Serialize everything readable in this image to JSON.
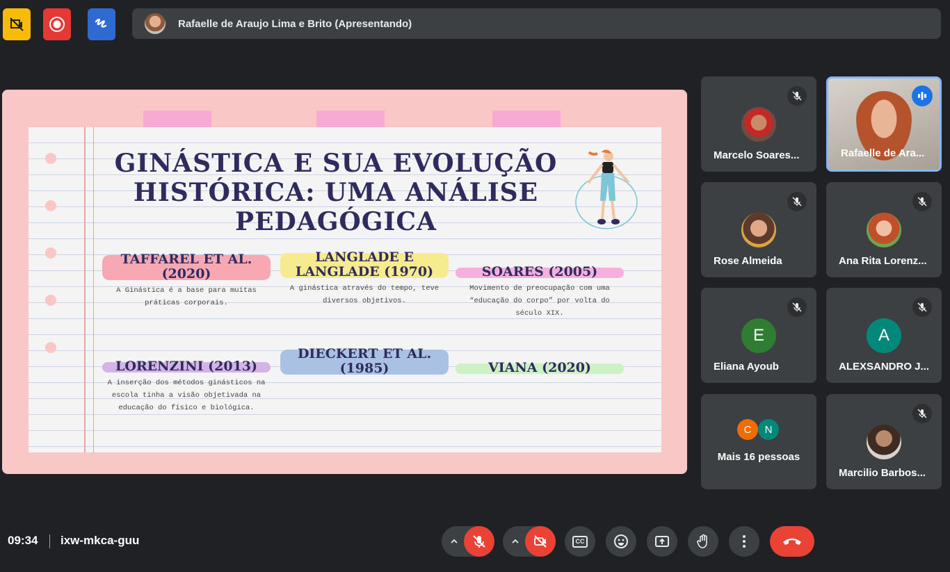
{
  "topbar": {
    "icons": [
      "no-camera-sign-icon",
      "record-icon",
      "whiteboard-icon"
    ],
    "colors": {
      "yellow": "#f9bb0a",
      "red": "#e53935",
      "blue": "#2f6ad0"
    },
    "presenter_label": "Rafaelle de Araujo Lima e Brito (Apresentando)"
  },
  "slide": {
    "title": "GINÁSTICA E SUA EVOLUÇÃO HISTÓRICA: UMA ANÁLISE PEDAGÓGICA",
    "columns": [
      {
        "title": "TAFFAREL ET AL. (2020)",
        "text": "A Ginástica é a base para muitas práticas corporais.",
        "color": "#f7a8b2"
      },
      {
        "title": "LANGLADE E LANGLADE (1970)",
        "text": "A ginástica através do tempo, teve diversos objetivos.",
        "color": "#f7eb8f"
      },
      {
        "title": "SOARES (2005)",
        "text": "Movimento de preocupação com uma “educação do corpo” por volta do século XIX.",
        "color": "#f6b0e0"
      },
      {
        "title": "LORENZINI (2013)",
        "text": "A inserção dos métodos ginásticos na escola tinha a visão objetivada na educação do físico e biológica.",
        "color": "#d4b3e6"
      },
      {
        "title": "DIECKERT ET AL. (1985)",
        "text": "",
        "color": "#a9c2e4"
      },
      {
        "title": "VIANA (2020)",
        "text": "",
        "color": "#cdf0c4"
      }
    ]
  },
  "participants": [
    {
      "name": "Marcelo Soares...",
      "type": "photo",
      "muted": true
    },
    {
      "name": "Rafaelle de Ara...",
      "type": "video",
      "speaking": true
    },
    {
      "name": "Rose Almeida",
      "type": "photo",
      "muted": true
    },
    {
      "name": "Ana Rita Lorenz...",
      "type": "photo",
      "muted": true
    },
    {
      "name": "Eliana Ayoub",
      "type": "initial",
      "initial": "E",
      "color": "#2e7d32",
      "muted": true
    },
    {
      "name": "ALEXSANDRO J...",
      "type": "initial",
      "initial": "A",
      "color": "#00897b",
      "muted": true
    },
    {
      "name": "Mais 16 pessoas",
      "type": "more",
      "initials": [
        "C",
        "N"
      ],
      "colors": [
        "#ef6c00",
        "#00897b"
      ]
    },
    {
      "name": "Marcilio Barbos...",
      "type": "photo",
      "muted": true
    }
  ],
  "bottombar": {
    "time": "09:34",
    "meeting_code": "ixw-mkca-guu",
    "controls": [
      "mic-off-icon",
      "camera-off-icon",
      "captions-icon",
      "emoji-icon",
      "present-icon",
      "raise-hand-icon",
      "more-icon",
      "end-call-icon"
    ],
    "captions_label": "CC"
  }
}
